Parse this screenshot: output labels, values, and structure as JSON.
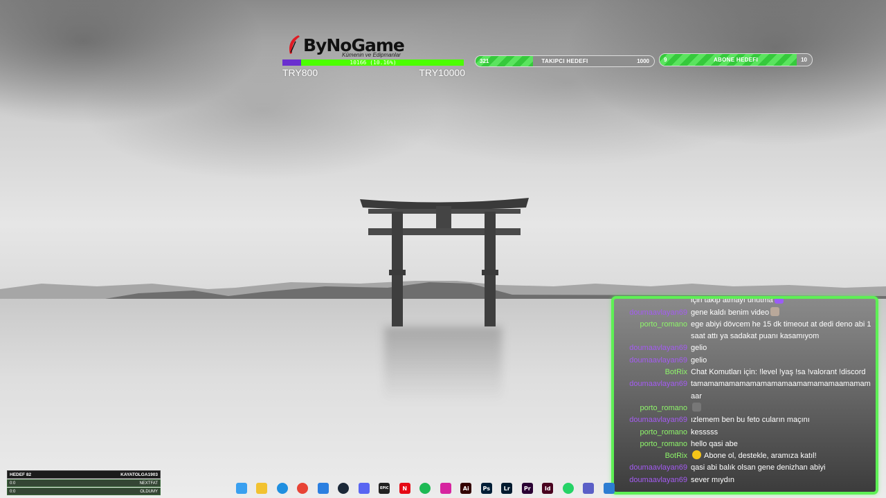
{
  "donation": {
    "logo_text": "ByNoGame",
    "subtitle": "Kümenin ve Edipmanlar",
    "progress_text": "10166 (10.16%)",
    "progress_percent": 10.16,
    "min_label": "TRY800",
    "max_label": "TRY10000",
    "brand_color": "#e01b24",
    "bar_color": "#4cff00",
    "fill_color": "#6a2fcf"
  },
  "follower_goal": {
    "current": "321",
    "label": "TAKIPCI HEDEFI",
    "target": "1000",
    "fill_percent": 32.1
  },
  "sub_goal": {
    "current": "9",
    "label": "ABONE HEDEFI",
    "target": "10",
    "fill_percent": 90
  },
  "chat": {
    "border_color": "#5ef055",
    "messages": [
      {
        "user": "",
        "text": "için takip atmayı unutma",
        "user_color": "purple",
        "emote": "heart-icon"
      },
      {
        "user": "doumaavlayan69",
        "text": "gene kaldı benim video",
        "user_color": "purple",
        "emote": "raccoon-emote"
      },
      {
        "user": "porto_romano",
        "text": "ege abiyi dövcem he 15 dk timeout at dedi deno abi 1 saat attı ya sadakat puanı kasamıyom",
        "user_color": "green"
      },
      {
        "user": "doumaavlayan69",
        "text": "gelio",
        "user_color": "purple"
      },
      {
        "user": "doumaavlayan69",
        "text": "gelio",
        "user_color": "purple"
      },
      {
        "user": "BotRix",
        "text": "Chat Komutları için: !level !yaş !sa !valorant !discord",
        "user_color": "green"
      },
      {
        "user": "doumaavlayan69",
        "text": "tamamamamamamamamamaamamamamaamamamaar",
        "user_color": "purple"
      },
      {
        "user": "porto_romano",
        "text": "",
        "user_color": "green",
        "emote": "gun-emote"
      },
      {
        "user": "doumaavlayan69",
        "text": "ızlemem ben bu feto cuların maçını",
        "user_color": "purple"
      },
      {
        "user": "porto_romano",
        "text": "kesssss",
        "user_color": "green"
      },
      {
        "user": "porto_romano",
        "text": "hello qasi abe",
        "user_color": "green"
      },
      {
        "user": "BotRix",
        "text": "Abone ol, destekle, aramıza katıl!",
        "user_color": "green",
        "emote_before": "star-icon"
      },
      {
        "user": "doumaavlayan69",
        "text": "qasi abi balık olsan gene denizhan abiyi",
        "user_color": "purple"
      },
      {
        "user": "doumaavlayan69",
        "text": "sever mıydın",
        "user_color": "purple"
      }
    ]
  },
  "taskbar": {
    "icons": [
      {
        "name": "windows-start-icon",
        "color": "#3aa0f0",
        "glyph": ""
      },
      {
        "name": "file-explorer-icon",
        "color": "#f2c230",
        "glyph": ""
      },
      {
        "name": "edge-browser-icon",
        "color": "#1f8fe0",
        "glyph": ""
      },
      {
        "name": "chrome-browser-icon",
        "color": "#e84335",
        "glyph": ""
      },
      {
        "name": "microsoft-store-icon",
        "color": "#2b7fe0",
        "glyph": ""
      },
      {
        "name": "steam-icon",
        "color": "#1b2838",
        "glyph": ""
      },
      {
        "name": "discord-icon",
        "color": "#5865f2",
        "glyph": ""
      },
      {
        "name": "epic-games-icon",
        "color": "#222222",
        "glyph": "EPIC"
      },
      {
        "name": "netflix-icon",
        "color": "#e50914",
        "glyph": "N"
      },
      {
        "name": "spotify-icon",
        "color": "#1db954",
        "glyph": ""
      },
      {
        "name": "instagram-icon",
        "color": "#d6249f",
        "glyph": ""
      },
      {
        "name": "illustrator-icon",
        "color": "#330000",
        "glyph": "Ai"
      },
      {
        "name": "photoshop-icon",
        "color": "#001e36",
        "glyph": "Ps"
      },
      {
        "name": "lightroom-icon",
        "color": "#001a2e",
        "glyph": "Lr"
      },
      {
        "name": "premiere-icon",
        "color": "#2a0033",
        "glyph": "Pr"
      },
      {
        "name": "indesign-icon",
        "color": "#49021f",
        "glyph": "Id"
      },
      {
        "name": "whatsapp-icon",
        "color": "#25d366",
        "glyph": ""
      },
      {
        "name": "teams-icon",
        "color": "#5b5fc7",
        "glyph": ""
      },
      {
        "name": "unknown-app-icon",
        "color": "#2d7dd2",
        "glyph": ""
      }
    ]
  },
  "scoreboard": {
    "header_left": "HEDEF 82",
    "header_right": "KAYATOLGA1903",
    "rows": [
      {
        "left": "0:0",
        "right": "NEXTFAT"
      },
      {
        "left": "0:0",
        "right": "OLDUMY"
      }
    ]
  }
}
